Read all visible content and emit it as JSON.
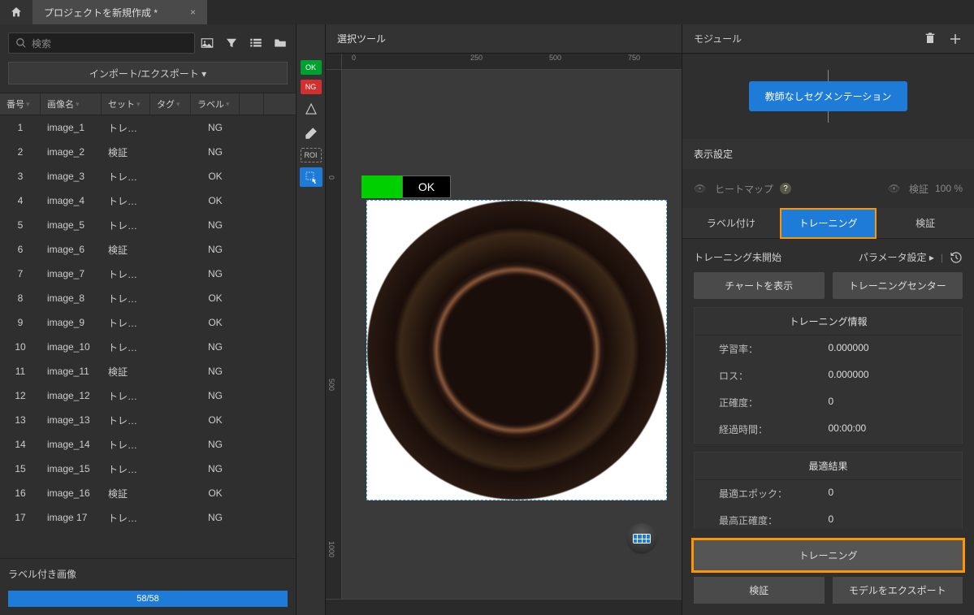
{
  "topbar": {
    "tab_title": "プロジェクトを新規作成 *"
  },
  "left": {
    "search_placeholder": "検索",
    "import_export": "インポート/エクスポート ▾",
    "columns": {
      "num": "番号",
      "name": "画像名",
      "set": "セット",
      "tag": "タグ",
      "label": "ラベル"
    },
    "rows": [
      {
        "n": "1",
        "name": "image_1",
        "set": "トレー…",
        "label": "NG"
      },
      {
        "n": "2",
        "name": "image_2",
        "set": "検証",
        "label": "NG"
      },
      {
        "n": "3",
        "name": "image_3",
        "set": "トレー…",
        "label": "OK"
      },
      {
        "n": "4",
        "name": "image_4",
        "set": "トレー…",
        "label": "OK"
      },
      {
        "n": "5",
        "name": "image_5",
        "set": "トレー…",
        "label": "NG"
      },
      {
        "n": "6",
        "name": "image_6",
        "set": "検証",
        "label": "NG"
      },
      {
        "n": "7",
        "name": "image_7",
        "set": "トレー…",
        "label": "NG"
      },
      {
        "n": "8",
        "name": "image_8",
        "set": "トレー…",
        "label": "OK"
      },
      {
        "n": "9",
        "name": "image_9",
        "set": "トレー…",
        "label": "OK"
      },
      {
        "n": "10",
        "name": "image_10",
        "set": "トレー…",
        "label": "NG"
      },
      {
        "n": "11",
        "name": "image_11",
        "set": "検証",
        "label": "NG"
      },
      {
        "n": "12",
        "name": "image_12",
        "set": "トレー…",
        "label": "NG"
      },
      {
        "n": "13",
        "name": "image_13",
        "set": "トレー…",
        "label": "OK"
      },
      {
        "n": "14",
        "name": "image_14",
        "set": "トレー…",
        "label": "NG"
      },
      {
        "n": "15",
        "name": "image_15",
        "set": "トレー…",
        "label": "NG"
      },
      {
        "n": "16",
        "name": "image_16",
        "set": "検証",
        "label": "OK"
      },
      {
        "n": "17",
        "name": "image 17",
        "set": "トレー…",
        "label": "NG"
      }
    ],
    "labeled_images": "ラベル付き画像",
    "progress_text": "58/58"
  },
  "toolbar": {
    "ok": "OK",
    "ng": "NG",
    "roi": "ROI"
  },
  "center": {
    "header": "選択ツール",
    "status_label": "OK",
    "ruler_h": [
      "0",
      "250",
      "500",
      "750"
    ],
    "ruler_v": [
      "0",
      "500",
      "1000"
    ]
  },
  "right": {
    "header": "モジュール",
    "module_btn": "教師なしセグメンテーション",
    "display_settings": "表示設定",
    "heatmap": "ヒートマップ",
    "verify": "検証",
    "verify_pct": "100 %",
    "tabs": {
      "labeling": "ラベル付け",
      "training": "トレーニング",
      "validation": "検証"
    },
    "training": {
      "status": "トレーニング未開始",
      "param_settings": "パラメータ設定 ▸",
      "show_chart": "チャートを表示",
      "training_center": "トレーニングセンター",
      "info_title": "トレーニング情報",
      "learning_rate_label": "学習率：",
      "learning_rate_value": "0.000000",
      "loss_label": "ロス：",
      "loss_value": "0.000000",
      "accuracy_label": "正確度：",
      "accuracy_value": "0",
      "elapsed_label": "経過時間：",
      "elapsed_value": "00:00:00",
      "best_title": "最適結果",
      "best_epoch_label": "最適エポック：",
      "best_epoch_value": "0",
      "best_accuracy_label": "最高正確度：",
      "best_accuracy_value": "0"
    },
    "footer": {
      "train": "トレーニング",
      "validate": "検証",
      "export_model": "モデルをエクスポート"
    }
  }
}
